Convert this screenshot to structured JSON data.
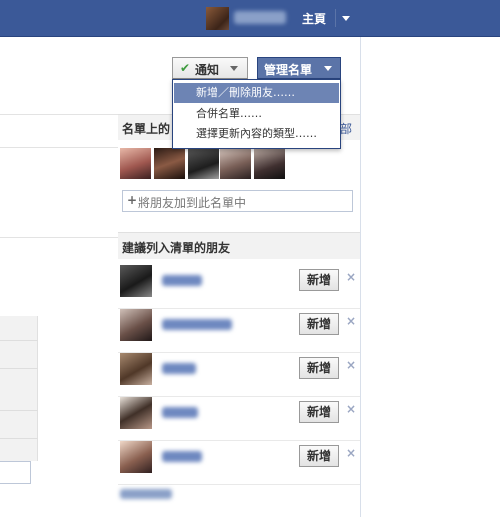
{
  "topbar": {
    "home_label": "主頁"
  },
  "buttons": {
    "notify_label": "通知",
    "manage_label": "管理名單"
  },
  "dropdown": {
    "items": [
      {
        "label": "新增／刪除朋友……"
      },
      {
        "label": "合併名單……"
      },
      {
        "label": "選擇更新內容的類型……"
      }
    ]
  },
  "members_section": {
    "title": "名單上的",
    "link_text": "部",
    "add_placeholder": "將朋友加到此名單中"
  },
  "suggestions": {
    "title": "建議列入清單的朋友",
    "add_label": "新增",
    "remove_symbol": "×",
    "rows": [
      {
        "name_width": 40
      },
      {
        "name_width": 70
      },
      {
        "name_width": 34
      },
      {
        "name_width": 36
      },
      {
        "name_width": 40
      }
    ]
  },
  "colors": {
    "topbar_bg": "#3b5998",
    "accent": "#6d84b4",
    "link": "#3b5998",
    "check": "#3d9b3d"
  },
  "icons": {
    "notify_check": "check-icon",
    "plus": "plus-icon",
    "remove": "close-icon"
  }
}
